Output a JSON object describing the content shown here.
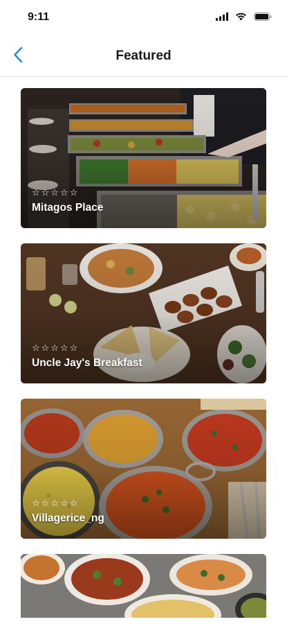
{
  "status_bar": {
    "time": "9:11",
    "icons": [
      "signal-icon",
      "wifi-icon",
      "battery-icon"
    ]
  },
  "header": {
    "title": "Featured",
    "back_icon": "chevron-left-icon",
    "accent_color": "#1a8cd8"
  },
  "restaurants": [
    {
      "name": "Mitagos Place",
      "rating_stars": "☆☆☆☆☆",
      "rating": 0
    },
    {
      "name": "Uncle Jay's Breakfast",
      "rating_stars": "☆☆☆☆☆",
      "rating": 0
    },
    {
      "name": "Villagerice_ng",
      "rating_stars": "☆☆☆☆☆",
      "rating": 0
    }
  ]
}
